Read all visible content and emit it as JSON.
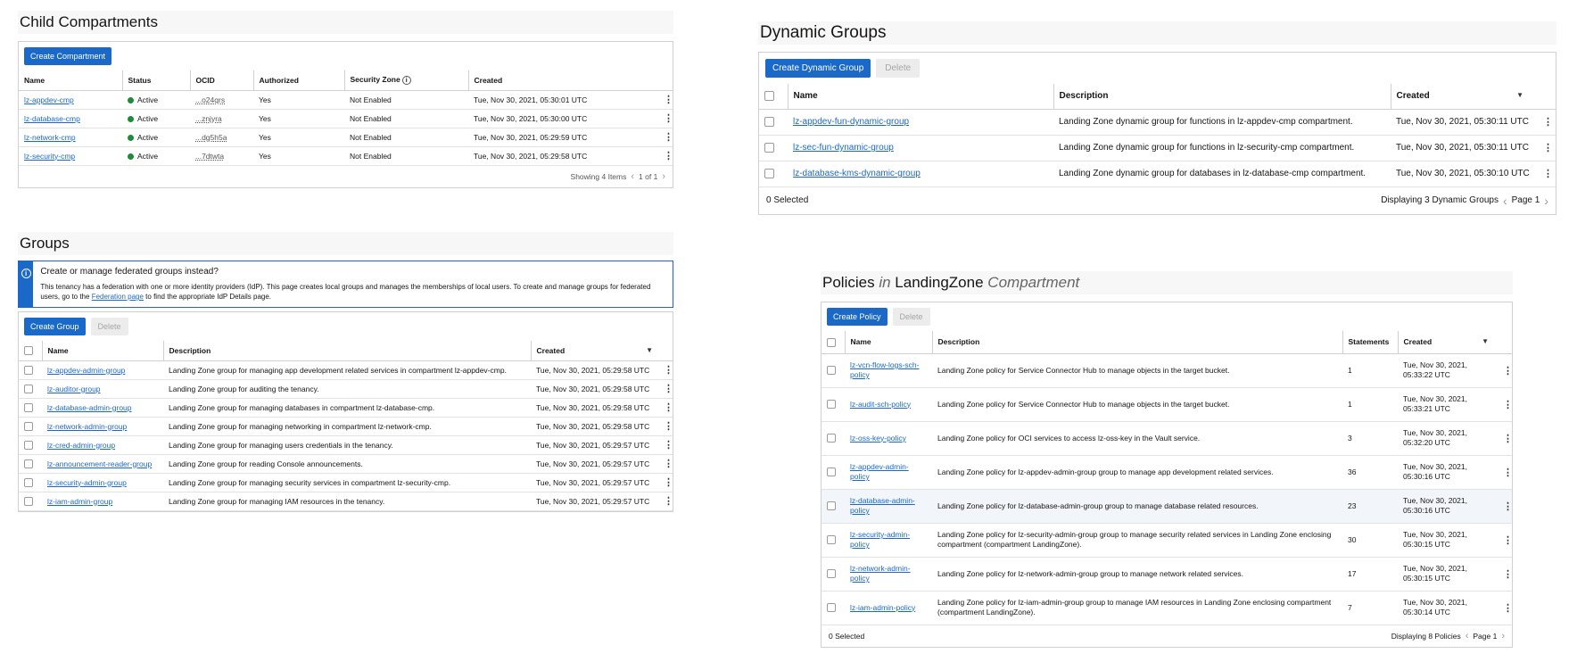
{
  "child_compartments": {
    "title": "Child Compartments",
    "create_label": "Create Compartment",
    "columns": [
      "Name",
      "Status",
      "OCID",
      "Authorized",
      "Security Zone",
      "Created"
    ],
    "rows": [
      {
        "name": "lz-appdev-cmp",
        "status": "Active",
        "ocid": "...o24qrs",
        "authorized": "Yes",
        "zone": "Not Enabled",
        "created": "Tue, Nov 30, 2021, 05:30:01 UTC"
      },
      {
        "name": "lz-database-cmp",
        "status": "Active",
        "ocid": "...znjyra",
        "authorized": "Yes",
        "zone": "Not Enabled",
        "created": "Tue, Nov 30, 2021, 05:30:00 UTC"
      },
      {
        "name": "lz-network-cmp",
        "status": "Active",
        "ocid": "...dg5h5a",
        "authorized": "Yes",
        "zone": "Not Enabled",
        "created": "Tue, Nov 30, 2021, 05:29:59 UTC"
      },
      {
        "name": "lz-security-cmp",
        "status": "Active",
        "ocid": "...7dtwta",
        "authorized": "Yes",
        "zone": "Not Enabled",
        "created": "Tue, Nov 30, 2021, 05:29:58 UTC"
      }
    ],
    "showing": "Showing 4 Items",
    "page": "1 of 1"
  },
  "groups": {
    "title": "Groups",
    "notice_title": "Create or manage federated groups instead?",
    "notice_text_1": "This tenancy has a federation with one or more identity providers (IdP). This page creates local groups and manages the memberships of local users. To create and manage groups for federated users, go to the ",
    "notice_link": "Federation page",
    "notice_text_2": " to find the appropriate IdP Details page.",
    "create_label": "Create Group",
    "delete_label": "Delete",
    "columns": [
      "Name",
      "Description",
      "Created"
    ],
    "rows": [
      {
        "name": "lz-appdev-admin-group",
        "desc": "Landing Zone group for managing app development related services in compartment lz-appdev-cmp.",
        "created": "Tue, Nov 30, 2021, 05:29:58 UTC"
      },
      {
        "name": "lz-auditor-group",
        "desc": "Landing Zone group for auditing the tenancy.",
        "created": "Tue, Nov 30, 2021, 05:29:58 UTC"
      },
      {
        "name": "lz-database-admin-group",
        "desc": "Landing Zone group for managing databases in compartment lz-database-cmp.",
        "created": "Tue, Nov 30, 2021, 05:29:58 UTC"
      },
      {
        "name": "lz-network-admin-group",
        "desc": "Landing Zone group for managing networking in compartment lz-network-cmp.",
        "created": "Tue, Nov 30, 2021, 05:29:58 UTC"
      },
      {
        "name": "lz-cred-admin-group",
        "desc": "Landing Zone group for managing users credentials in the tenancy.",
        "created": "Tue, Nov 30, 2021, 05:29:57 UTC"
      },
      {
        "name": "lz-announcement-reader-group",
        "desc": "Landing Zone group for reading Console announcements.",
        "created": "Tue, Nov 30, 2021, 05:29:57 UTC"
      },
      {
        "name": "lz-security-admin-group",
        "desc": "Landing Zone group for managing security services in compartment lz-security-cmp.",
        "created": "Tue, Nov 30, 2021, 05:29:57 UTC"
      },
      {
        "name": "lz-iam-admin-group",
        "desc": "Landing Zone group for managing IAM resources in the tenancy.",
        "created": "Tue, Nov 30, 2021, 05:29:57 UTC"
      }
    ]
  },
  "dynamic_groups": {
    "title": "Dynamic Groups",
    "create_label": "Create Dynamic Group",
    "delete_label": "Delete",
    "columns": [
      "Name",
      "Description",
      "Created"
    ],
    "rows": [
      {
        "name": "lz-appdev-fun-dynamic-group",
        "desc": "Landing Zone dynamic group for functions in lz-appdev-cmp compartment.",
        "created": "Tue, Nov 30, 2021, 05:30:11 UTC"
      },
      {
        "name": "lz-sec-fun-dynamic-group",
        "desc": "Landing Zone dynamic group for functions in lz-security-cmp compartment.",
        "created": "Tue, Nov 30, 2021, 05:30:11 UTC"
      },
      {
        "name": "lz-database-kms-dynamic-group",
        "desc": "Landing Zone dynamic group for databases in lz-database-cmp compartment.",
        "created": "Tue, Nov 30, 2021, 05:30:10 UTC"
      }
    ],
    "selected": "0 Selected",
    "displaying": "Displaying 3 Dynamic Groups",
    "page": "Page 1"
  },
  "policies": {
    "title_1": "Policies",
    "title_in": "in",
    "title_2": "LandingZone",
    "title_3": "Compartment",
    "create_label": "Create Policy",
    "delete_label": "Delete",
    "columns": [
      "Name",
      "Description",
      "Statements",
      "Created"
    ],
    "rows": [
      {
        "name": "lz-vcn-flow-logs-sch-policy",
        "desc": "Landing Zone policy for Service Connector Hub to manage objects in the target bucket.",
        "statements": "1",
        "created": "Tue, Nov 30, 2021, 05:33:22 UTC"
      },
      {
        "name": "lz-audit-sch-policy",
        "desc": "Landing Zone policy for Service Connector Hub to manage objects in the target bucket.",
        "statements": "1",
        "created": "Tue, Nov 30, 2021, 05:33:21 UTC"
      },
      {
        "name": "lz-oss-key-policy",
        "desc": "Landing Zone policy for OCI services to access lz-oss-key in the Vault service.",
        "statements": "3",
        "created": "Tue, Nov 30, 2021, 05:32:20 UTC"
      },
      {
        "name": "lz-appdev-admin-policy",
        "desc": "Landing Zone policy for lz-appdev-admin-group group to manage app development related services.",
        "statements": "36",
        "created": "Tue, Nov 30, 2021, 05:30:16 UTC"
      },
      {
        "name": "lz-database-admin-policy",
        "desc": "Landing Zone policy for lz-database-admin-group group to manage database related resources.",
        "statements": "23",
        "created": "Tue, Nov 30, 2021, 05:30:16 UTC"
      },
      {
        "name": "lz-security-admin-policy",
        "desc": "Landing Zone policy for lz-security-admin-group group to manage security related services in Landing Zone enclosing compartment (compartment LandingZone).",
        "statements": "30",
        "created": "Tue, Nov 30, 2021, 05:30:15 UTC"
      },
      {
        "name": "lz-network-admin-policy",
        "desc": "Landing Zone policy for lz-network-admin-group group to manage network related services.",
        "statements": "17",
        "created": "Tue, Nov 30, 2021, 05:30:15 UTC"
      },
      {
        "name": "lz-iam-admin-policy",
        "desc": "Landing Zone policy for lz-iam-admin-group group to manage IAM resources in Landing Zone enclosing compartment (compartment LandingZone).",
        "statements": "7",
        "created": "Tue, Nov 30, 2021, 05:30:14 UTC"
      }
    ],
    "selected": "0 Selected",
    "displaying": "Displaying 8 Policies",
    "page": "Page 1"
  }
}
